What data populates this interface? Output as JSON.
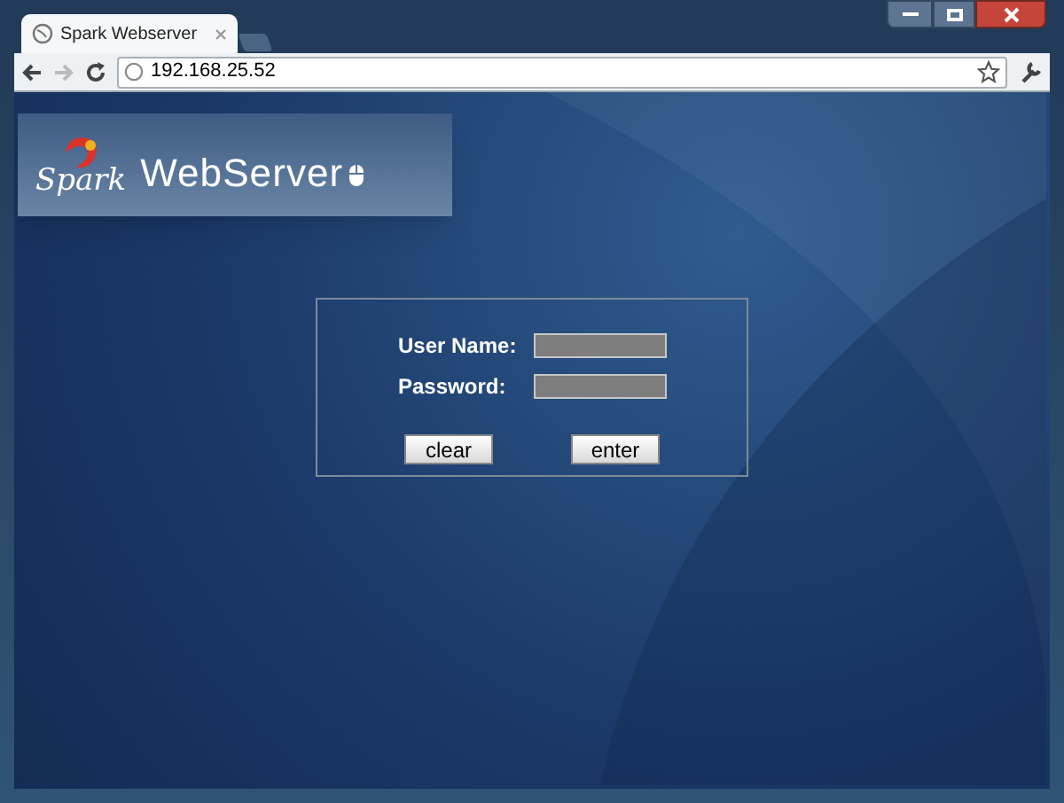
{
  "window": {
    "tab_title": "Spark Webserver"
  },
  "toolbar": {
    "address": "192.168.25.52"
  },
  "logo": {
    "brand": "Spark",
    "product": "WebServer"
  },
  "login": {
    "fields": [
      {
        "label": "User Name:"
      },
      {
        "label": "Password:"
      }
    ],
    "buttons": [
      "clear",
      "enter"
    ]
  }
}
